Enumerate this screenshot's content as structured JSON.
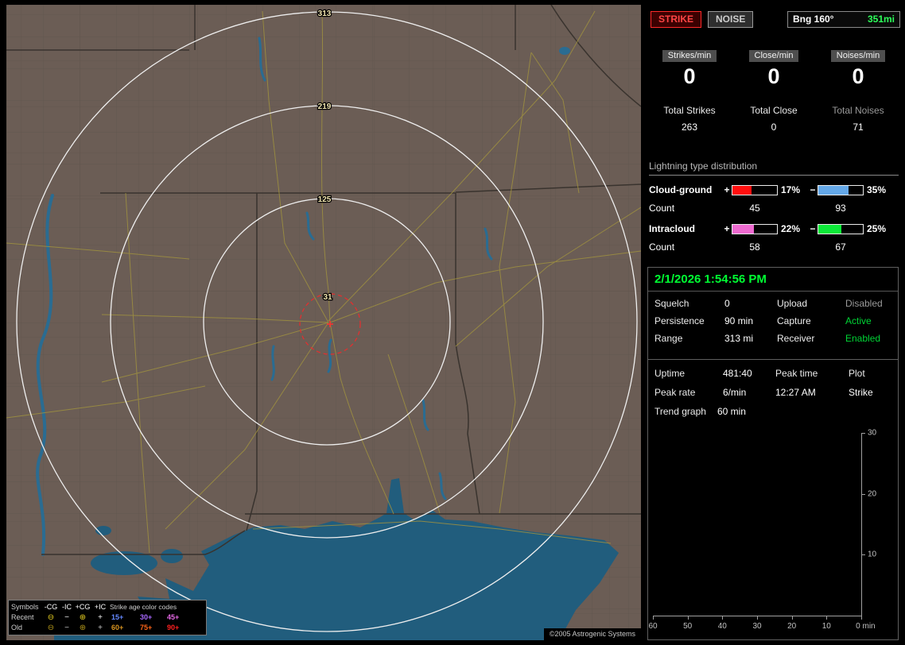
{
  "toolbar": {
    "strike": "STRIKE",
    "noise": "NOISE",
    "bearing_label": "Bng 160°",
    "bearing_value": "351mi"
  },
  "counters": {
    "strikes": {
      "label": "Strikes/min",
      "value": "0"
    },
    "close": {
      "label": "Close/min",
      "value": "0"
    },
    "noises": {
      "label": "Noises/min",
      "value": "0"
    }
  },
  "totals": {
    "strikes": {
      "label": "Total Strikes",
      "value": "263"
    },
    "close": {
      "label": "Total Close",
      "value": "0"
    },
    "noises": {
      "label": "Total Noises",
      "value": "71"
    }
  },
  "distribution": {
    "title": "Lightning type distribution",
    "cloud_ground": {
      "label": "Cloud-ground",
      "plus": "+",
      "minus": "−",
      "pos_pct": "17%",
      "neg_pct": "35%",
      "count_label": "Count",
      "pos_count": "45",
      "neg_count": "93",
      "pos_style": "width:42%;background:#ff0e0e",
      "neg_style": "width:68%;background:#64a8e8"
    },
    "intracloud": {
      "label": "Intracloud",
      "plus": "+",
      "minus": "−",
      "pos_pct": "22%",
      "neg_pct": "25%",
      "count_label": "Count",
      "pos_count": "58",
      "neg_count": "67",
      "pos_style": "width:48%;background:#ee6ad0",
      "neg_style": "width:52%;background:#0ce838"
    }
  },
  "status": {
    "datetime": "2/1/2026 1:54:56 PM",
    "squelch_label": "Squelch",
    "squelch": "0",
    "persistence_label": "Persistence",
    "persistence": "90 min",
    "range_label": "Range",
    "range": "313 mi",
    "upload_label": "Upload",
    "upload": "Disabled",
    "capture_label": "Capture",
    "capture": "Active",
    "receiver_label": "Receiver",
    "receiver": "Enabled"
  },
  "session": {
    "uptime_label": "Uptime",
    "uptime": "481:40",
    "peak_rate_label": "Peak rate",
    "peak_rate": "6/min",
    "peak_time_label": "Peak time",
    "peak_time": "12:27 AM",
    "plot_label": "Plot",
    "plot": "Strike",
    "trend_label": "Trend graph",
    "trend_value": "60 min"
  },
  "trend_graph": {
    "y_ticks": [
      "30",
      "20",
      "10"
    ],
    "x_ticks": [
      "60",
      "50",
      "40",
      "30",
      "20",
      "10"
    ],
    "x_end": "0 min"
  },
  "map": {
    "rings": [
      "313",
      "219",
      "125",
      "31"
    ],
    "copyright": "©2005 Astrogenic Systems",
    "legend": {
      "symbols_header": "Symbols",
      "col_cg_neg": "-CG",
      "col_ic_neg": "-IC",
      "col_cg_pos": "+CG",
      "col_ic_pos": "+IC",
      "age_header": "Strike age color codes",
      "recent_label": "Recent",
      "old_label": "Old",
      "recent_syms": [
        "⊖",
        "−",
        "⊕",
        "+"
      ],
      "old_syms": [
        "⊖",
        "−",
        "⊕",
        "+"
      ],
      "recent_ages": [
        {
          "t": "15+",
          "s": "color:#6488ff"
        },
        {
          "t": "30+",
          "s": "color:#a868ff"
        },
        {
          "t": "45+",
          "s": "color:#e668e6"
        }
      ],
      "old_ages": [
        {
          "t": "60+",
          "s": "color:#d89420"
        },
        {
          "t": "75+",
          "s": "color:#ff6418"
        },
        {
          "t": "90+",
          "s": "color:#ff2020"
        }
      ]
    }
  }
}
